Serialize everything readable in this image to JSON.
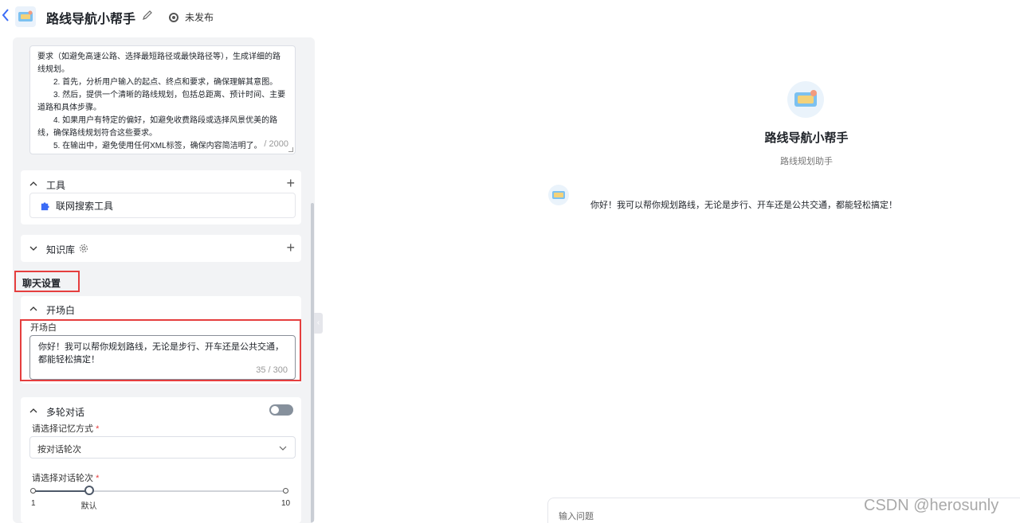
{
  "header": {
    "app_title": "路线导航小帮手",
    "status": "未发布"
  },
  "prompt": {
    "lines": [
      "要求（如避免高速公路、选择最短路径或最快路径等），生成详细的路线规划。",
      "2. 首先，分析用户输入的起点、终点和要求，确保理解其意图。",
      "3. 然后，提供一个清晰的路线规划，包括总距离、预计时间、主要道路和具体步骤。",
      "4. 如果用户有特定的偏好，如避免收费路段或选择风景优美的路线，确保路线规划符合这些要求。",
      "5. 在输出中，避免使用任何XML标签，确保内容简洁明了。"
    ],
    "count": "/ 2000"
  },
  "tools": {
    "title": "工具",
    "items": [
      {
        "label": "联网搜索工具"
      }
    ]
  },
  "knowledge": {
    "title": "知识库"
  },
  "chat_settings": {
    "section_label": "聊天设置",
    "opening": {
      "title": "开场白",
      "field_label": "开场白",
      "value": "你好！我可以帮你规划路线，无论是步行、开车还是公共交通，都能轻松搞定！",
      "count": "35 / 300"
    },
    "multi_turn": {
      "title": "多轮对话",
      "enabled": false,
      "memory_label": "请选择记忆方式",
      "memory_value": "按对话轮次",
      "rounds_label": "请选择对话轮次",
      "slider_min": "1",
      "slider_default_label": "默认",
      "slider_max": "10",
      "slider_value": 3
    }
  },
  "preview": {
    "title": "路线导航小帮手",
    "subtitle": "路线规划助手",
    "greeting": "你好！我可以帮你规划路线，无论是步行、开车还是公共交通，都能轻松搞定！",
    "input_placeholder": "输入问题"
  },
  "watermark": "CSDN @herosunly",
  "colors": {
    "accent": "#3b6cf6",
    "highlight_border": "#e53e3e",
    "panel_bg": "#f2f3f5"
  },
  "icons": {
    "back": "chevron-left-icon",
    "edit": "pencil-icon",
    "status": "status-circle-icon",
    "tool": "puzzle-icon",
    "settings": "gear-icon"
  }
}
